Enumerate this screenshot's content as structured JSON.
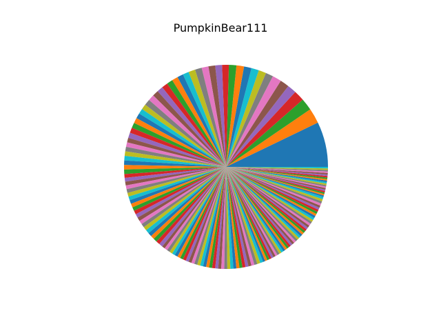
{
  "chart_data": {
    "type": "pie",
    "title": "PumpkinBear111",
    "start_angle_deg": 0,
    "direction": "counterclockwise",
    "slice_count": 160,
    "color_cycle": [
      "#1f77b4",
      "#ff7f0e",
      "#2ca02c",
      "#d62728",
      "#9467bd",
      "#8c564b",
      "#e377c2",
      "#7f7f7f",
      "#bcbd22",
      "#17becf"
    ],
    "values": [
      30,
      10,
      8,
      7,
      6,
      6,
      6,
      5,
      5,
      5,
      5,
      5,
      5,
      4.5,
      4.5,
      4.5,
      4.5,
      4.5,
      4.5,
      4,
      4,
      4,
      4,
      4,
      4,
      4,
      4,
      4,
      3.5,
      3.5,
      3.5,
      3.5,
      3.5,
      3.5,
      3.5,
      3,
      3,
      3,
      3,
      3,
      3,
      3,
      3,
      2.5,
      2.5,
      2.5,
      2.5,
      2.5,
      2.5,
      2.5,
      2.5,
      2.5,
      2.5,
      2.5,
      2.5,
      2.5,
      2.5,
      2.5,
      2.5,
      2.5,
      2.5,
      2.5,
      2.5,
      2.5,
      2.5,
      2,
      2,
      2,
      2,
      2,
      2,
      2,
      2,
      2,
      2,
      2,
      2,
      2,
      2,
      2,
      2,
      2,
      2,
      2,
      2,
      2,
      2,
      2,
      2,
      2,
      2,
      2,
      2,
      2,
      2,
      2,
      2,
      2,
      2,
      2,
      1.5,
      1.5,
      1.5,
      1.5,
      1.5,
      1.5,
      1.5,
      1.5,
      1.5,
      1.5,
      1.5,
      1.5,
      1.5,
      1.5,
      1.5,
      1.5,
      1.5,
      1.5,
      1.5,
      1.5,
      1.5,
      1.5,
      1.5,
      1.5,
      1.5,
      1.5,
      1.5,
      1.5,
      1.5,
      1.5,
      1.5,
      1.5,
      1.5,
      1.5,
      1.5,
      1.5,
      1.5,
      1.5,
      1.5,
      1.5,
      1,
      1,
      1,
      1,
      1,
      1,
      1,
      1,
      1,
      1,
      1,
      1,
      1,
      1,
      1,
      1,
      1,
      1,
      1,
      1
    ]
  }
}
